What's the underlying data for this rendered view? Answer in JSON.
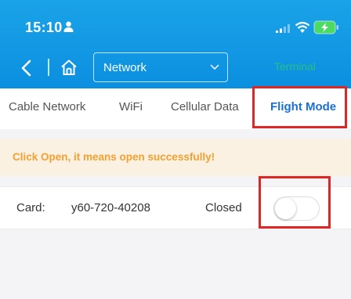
{
  "status_bar": {
    "time": "15:10"
  },
  "nav": {
    "select_value": "Network",
    "terminal_label": "Terminal"
  },
  "tabs": [
    {
      "label": "Cable Network",
      "active": false
    },
    {
      "label": "WiFi",
      "active": false
    },
    {
      "label": "Cellular Data",
      "active": false
    },
    {
      "label": "Flight Mode",
      "active": true
    }
  ],
  "notice": {
    "text": "Click Open, it means open successfully!"
  },
  "card_row": {
    "label": "Card:",
    "id": "y60-720-40208",
    "status": "Closed",
    "toggle_on": false
  },
  "colors": {
    "header": "#0b8fe0",
    "active_tab": "#1a6fd8",
    "notice_text": "#f3a12f",
    "notice_bg": "#fbf1e3",
    "highlight": "#e02525",
    "terminal": "#3de03d"
  },
  "icons": [
    "person-icon",
    "signal-icon",
    "wifi-icon",
    "battery-charging-icon",
    "back-icon",
    "home-icon",
    "chevron-down-icon"
  ]
}
